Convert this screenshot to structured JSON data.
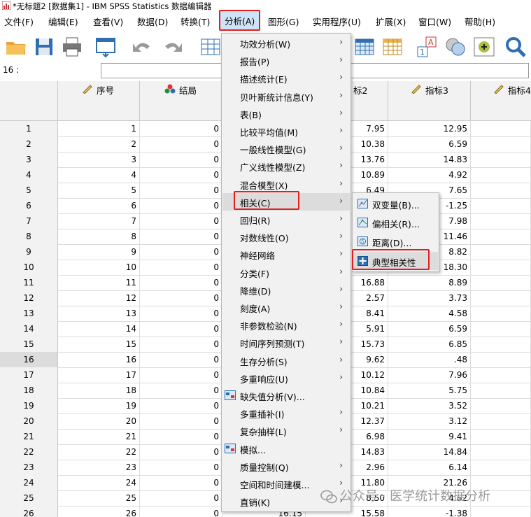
{
  "window": {
    "title": "*无标题2 [数据集1] - IBM SPSS Statistics 数据编辑器"
  },
  "menubar": [
    {
      "label": "文件(F)"
    },
    {
      "label": "编辑(E)"
    },
    {
      "label": "查看(V)"
    },
    {
      "label": "数据(D)"
    },
    {
      "label": "转换(T)"
    },
    {
      "label": "分析(A)"
    },
    {
      "label": "图形(G)"
    },
    {
      "label": "实用程序(U)"
    },
    {
      "label": "扩展(X)"
    },
    {
      "label": "窗口(W)"
    },
    {
      "label": "帮助(H)"
    }
  ],
  "toolbar": {
    "icons": [
      "open-folder-icon",
      "save-icon",
      "print-icon",
      "dialog-recall-icon",
      "undo-icon",
      "redo-icon",
      "goto-case-icon",
      "table-icon",
      "table-highlight-icon",
      "value-labels-icon",
      "sets-icon",
      "add-variable-icon",
      "search-icon"
    ]
  },
  "cell_ref": {
    "label": "16 :",
    "value": ""
  },
  "grid": {
    "columns": [
      {
        "name": "序号",
        "icon": "scale-ruler-icon"
      },
      {
        "name": "结局",
        "icon": "nominal-balls-icon"
      },
      {
        "name": "",
        "icon": ""
      },
      {
        "name": "标2",
        "icon": ""
      },
      {
        "name": "指标3",
        "icon": "scale-ruler-icon"
      },
      {
        "name": "指标4",
        "icon": "scale-ruler-icon"
      }
    ],
    "selected_row": 16,
    "rows": [
      {
        "n": "1",
        "c1": "1",
        "c2": "0",
        "c4": "7.95",
        "c5": "12.95"
      },
      {
        "n": "2",
        "c1": "2",
        "c2": "0",
        "c4": "10.38",
        "c5": "6.59"
      },
      {
        "n": "3",
        "c1": "3",
        "c2": "0",
        "c4": "13.76",
        "c5": "14.83"
      },
      {
        "n": "4",
        "c1": "4",
        "c2": "0",
        "c4": "10.89",
        "c5": "4.92"
      },
      {
        "n": "5",
        "c1": "5",
        "c2": "0",
        "c4": "6.49",
        "c5": "7.65"
      },
      {
        "n": "6",
        "c1": "6",
        "c2": "0",
        "c4": "",
        "c5": "-1.25"
      },
      {
        "n": "7",
        "c1": "7",
        "c2": "0",
        "c4": "",
        "c5": "7.98"
      },
      {
        "n": "8",
        "c1": "8",
        "c2": "0",
        "c4": "",
        "c5": "11.46"
      },
      {
        "n": "9",
        "c1": "9",
        "c2": "0",
        "c4": "",
        "c5": "8.82"
      },
      {
        "n": "10",
        "c1": "10",
        "c2": "0",
        "c4": "",
        "c5": "18.30"
      },
      {
        "n": "11",
        "c1": "11",
        "c2": "0",
        "c4": "16.88",
        "c5": "8.89"
      },
      {
        "n": "12",
        "c1": "12",
        "c2": "0",
        "c4": "2.57",
        "c5": "3.73"
      },
      {
        "n": "13",
        "c1": "13",
        "c2": "0",
        "c4": "8.41",
        "c5": "4.58"
      },
      {
        "n": "14",
        "c1": "14",
        "c2": "0",
        "c4": "5.91",
        "c5": "6.59"
      },
      {
        "n": "15",
        "c1": "15",
        "c2": "0",
        "c4": "15.73",
        "c5": "6.85"
      },
      {
        "n": "16",
        "c1": "16",
        "c2": "0",
        "c4": "9.62",
        "c5": ".48"
      },
      {
        "n": "17",
        "c1": "17",
        "c2": "0",
        "c4": "10.12",
        "c5": "7.96"
      },
      {
        "n": "18",
        "c1": "18",
        "c2": "0",
        "c4": "10.84",
        "c5": "5.75"
      },
      {
        "n": "19",
        "c1": "19",
        "c2": "0",
        "c4": "10.21",
        "c5": "3.52"
      },
      {
        "n": "20",
        "c1": "20",
        "c2": "0",
        "c4": "12.37",
        "c5": "3.12"
      },
      {
        "n": "21",
        "c1": "21",
        "c2": "0",
        "c4": "6.98",
        "c5": "9.41"
      },
      {
        "n": "22",
        "c1": "22",
        "c2": "0",
        "c4": "14.83",
        "c5": "14.84"
      },
      {
        "n": "23",
        "c1": "23",
        "c2": "0",
        "c4": "2.96",
        "c5": "6.14"
      },
      {
        "n": "24",
        "c1": "24",
        "c2": "0",
        "c4": "11.80",
        "c5": "21.26"
      },
      {
        "n": "25",
        "c1": "25",
        "c2": "0",
        "c4": "8.50",
        "c5": "4.62"
      },
      {
        "n": "26",
        "c1": "26",
        "c2": "0",
        "c3": "16.15",
        "c4": "15.58",
        "c5": "-1.38"
      }
    ]
  },
  "analyze_menu": {
    "items": [
      {
        "label": "功效分析(W)",
        "sub": true
      },
      {
        "label": "报告(P)",
        "sub": true
      },
      {
        "label": "描述统计(E)",
        "sub": true
      },
      {
        "label": "贝叶斯统计信息(Y)",
        "sub": true
      },
      {
        "label": "表(B)",
        "sub": true
      },
      {
        "label": "比较平均值(M)",
        "sub": true
      },
      {
        "label": "一般线性模型(G)",
        "sub": true
      },
      {
        "label": "广义线性模型(Z)",
        "sub": true
      },
      {
        "label": "混合模型(X)",
        "sub": true
      },
      {
        "label": "相关(C)",
        "sub": true,
        "highlight": true
      },
      {
        "label": "回归(R)",
        "sub": true
      },
      {
        "label": "对数线性(O)",
        "sub": true
      },
      {
        "label": "神经网络",
        "sub": true
      },
      {
        "label": "分类(F)",
        "sub": true
      },
      {
        "label": "降维(D)",
        "sub": true
      },
      {
        "label": "刻度(A)",
        "sub": true
      },
      {
        "label": "非参数检验(N)",
        "sub": true
      },
      {
        "label": "时间序列预测(T)",
        "sub": true
      },
      {
        "label": "生存分析(S)",
        "sub": true
      },
      {
        "label": "多重响应(U)",
        "sub": true
      },
      {
        "label": "缺失值分析(V)...",
        "sub": false,
        "icon": "missing-value-icon"
      },
      {
        "label": "多重插补(I)",
        "sub": true
      },
      {
        "label": "复杂抽样(L)",
        "sub": true
      },
      {
        "label": "模拟...",
        "sub": false,
        "icon": "simulation-icon"
      },
      {
        "label": "质量控制(Q)",
        "sub": true
      },
      {
        "label": "空间和时间建模...",
        "sub": true
      },
      {
        "label": "直销(K)",
        "sub": true
      }
    ]
  },
  "correlate_submenu": {
    "items": [
      {
        "label": "双变量(B)...",
        "icon": "bivariate-icon"
      },
      {
        "label": "偏相关(R)...",
        "icon": "partial-corr-icon"
      },
      {
        "label": "距离(D)...",
        "icon": "distance-icon"
      },
      {
        "label": "典型相关性",
        "icon": "canonical-corr-icon",
        "highlight": true
      }
    ]
  },
  "watermark": {
    "text": "公众号 · 医学统计数据分析"
  },
  "colors": {
    "accent_red": "#e02020",
    "menu_bg": "#f1f1f1",
    "header_bg": "#f2f2f2",
    "highlight_bg": "#cfe3f7"
  }
}
